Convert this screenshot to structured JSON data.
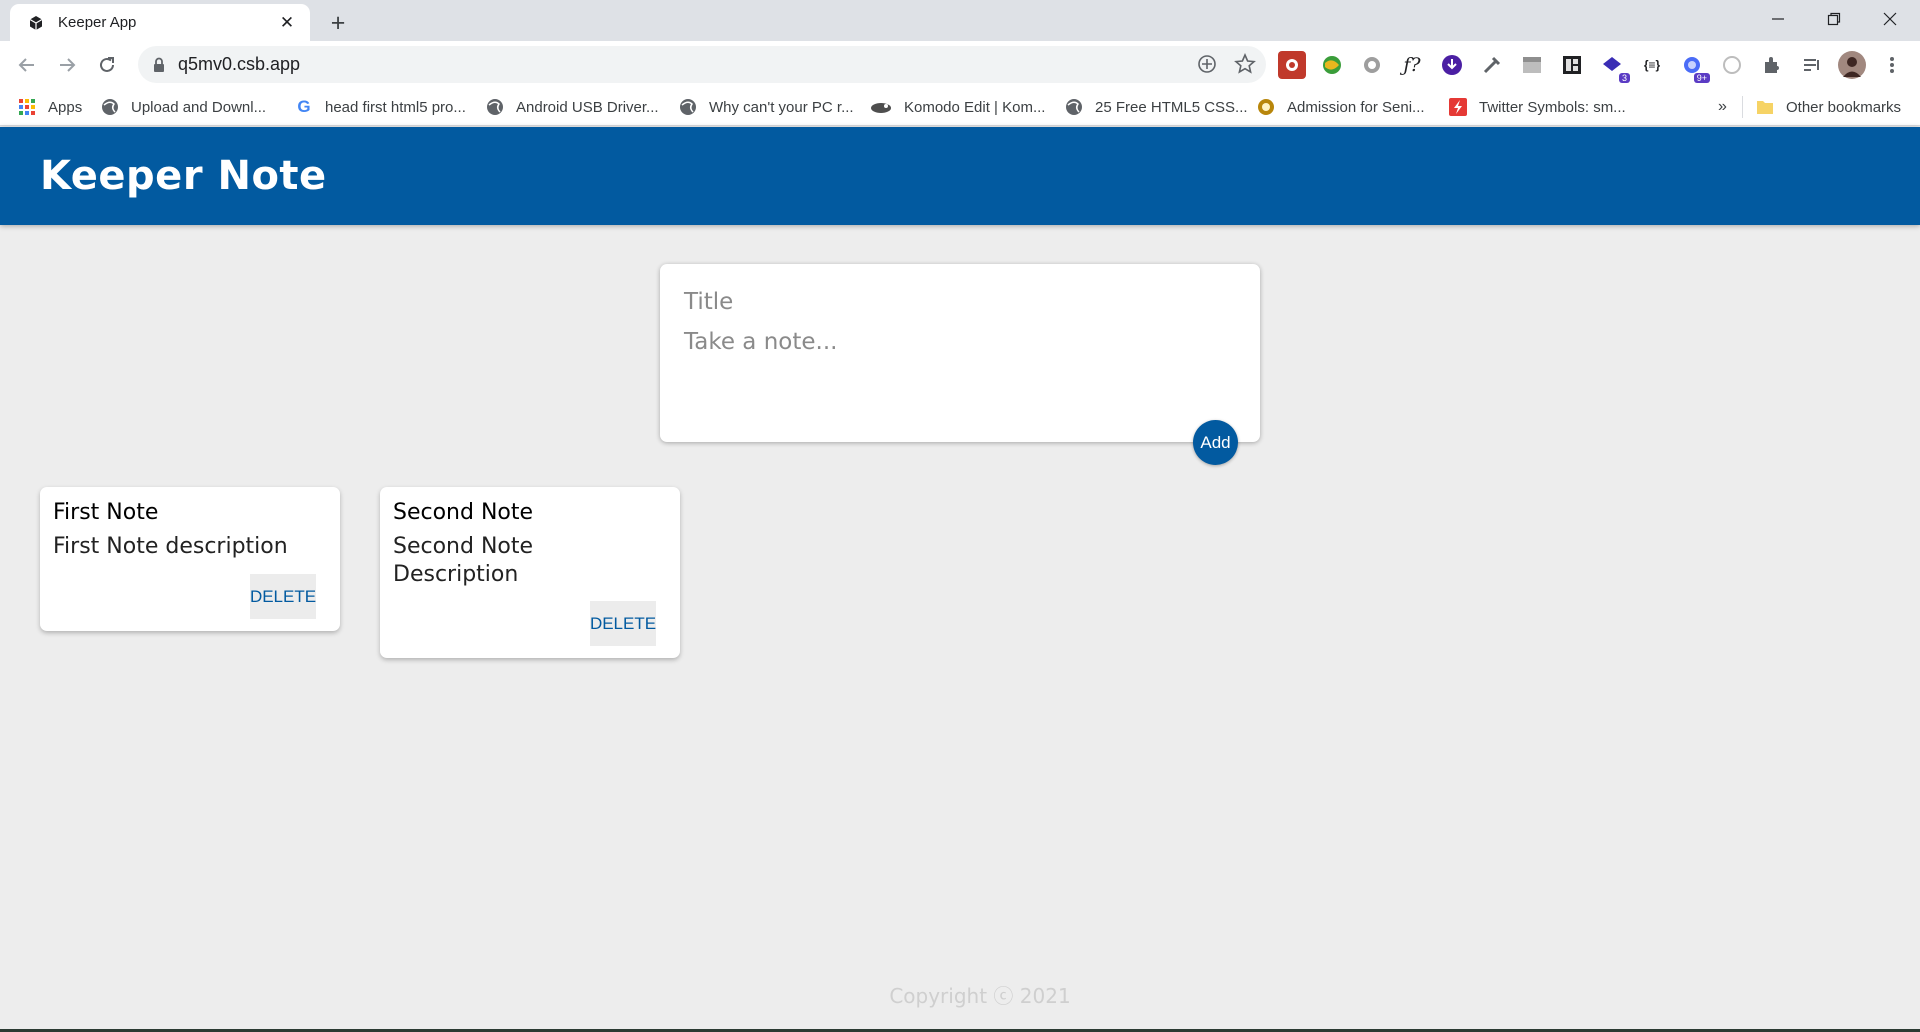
{
  "browser": {
    "tab_title": "Keeper App",
    "tab_close": "✕",
    "new_tab": "+",
    "url": "q5mv0.csb.app",
    "bookmarks": [
      {
        "label": "Apps",
        "icon": "apps-grid-icon"
      },
      {
        "label": "Upload and Downl...",
        "icon": "globe-icon"
      },
      {
        "label": "head first html5 pro...",
        "icon": "google-icon"
      },
      {
        "label": "Android USB Driver...",
        "icon": "globe-icon"
      },
      {
        "label": "Why can't your PC r...",
        "icon": "globe-icon"
      },
      {
        "label": "Komodo Edit | Kom...",
        "icon": "komodo-icon"
      },
      {
        "label": "25 Free HTML5 CSS...",
        "icon": "globe-icon"
      },
      {
        "label": "Admission for Seni...",
        "icon": "admission-icon"
      },
      {
        "label": "Twitter Symbols: sm...",
        "icon": "twitter-symbols-icon"
      }
    ],
    "more_bookmarks": "»",
    "other_bookmarks": "Other bookmarks",
    "ext_badges": {
      "calendar": "3",
      "ninja": "9+"
    }
  },
  "app": {
    "title": "Keeper Note",
    "composer": {
      "title_placeholder": "Title",
      "content_placeholder": "Take a note...",
      "add_label": "Add"
    },
    "notes": [
      {
        "title": "First Note",
        "content": "First Note description",
        "delete_label": "DELETE"
      },
      {
        "title": "Second Note",
        "content": "Second Note Description",
        "delete_label": "DELETE"
      }
    ],
    "footer": "Copyright ⓒ 2021"
  },
  "colors": {
    "header": "#025aa0",
    "background": "#ededed",
    "delete_text": "#025aa0"
  }
}
